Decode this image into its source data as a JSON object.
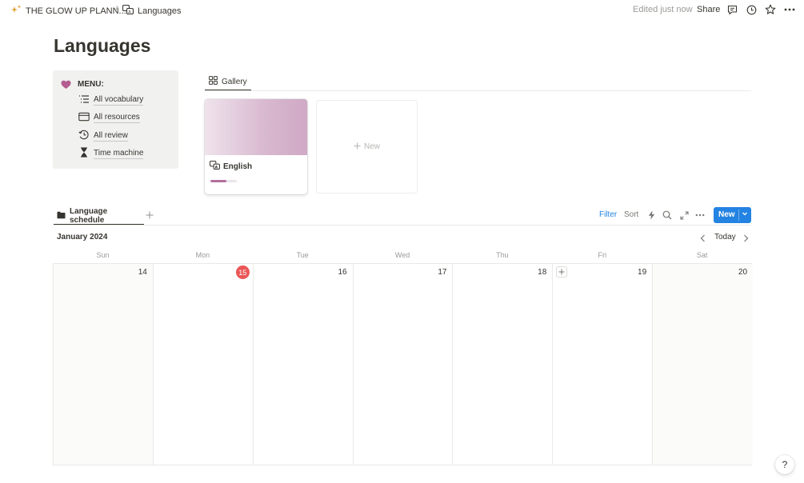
{
  "topbar": {
    "workspace_label": "THE GLOW UP PLANN...",
    "separator": "/",
    "page_label": "Languages",
    "edited_text": "Edited just now",
    "share_label": "Share"
  },
  "page": {
    "title": "Languages"
  },
  "menu": {
    "title": "MENU:",
    "items": [
      {
        "label": "All vocabulary",
        "icon": "list-icon"
      },
      {
        "label": "All resources",
        "icon": "card-icon"
      },
      {
        "label": "All review",
        "icon": "history-icon"
      },
      {
        "label": "Time machine",
        "icon": "hourglass-icon"
      }
    ]
  },
  "gallery": {
    "tab_label": "Gallery",
    "cards": [
      {
        "title": "English",
        "progress": 0.6
      }
    ],
    "new_label": "New"
  },
  "calendar": {
    "tab_label": "Language schedule",
    "filter_label": "Filter",
    "sort_label": "Sort",
    "new_label": "New",
    "month_label": "January 2024",
    "today_label": "Today",
    "weekdays": [
      "Sun",
      "Mon",
      "Tue",
      "Wed",
      "Thu",
      "Fri",
      "Sat"
    ],
    "days": [
      "14",
      "15",
      "16",
      "17",
      "18",
      "19",
      "20"
    ],
    "today_index": 1
  },
  "help": {
    "label": "?"
  },
  "colors": {
    "accent": "#2383e2",
    "today_badge": "#eb5757",
    "heart": "#b35c8f",
    "progress": "#b36f9c"
  }
}
